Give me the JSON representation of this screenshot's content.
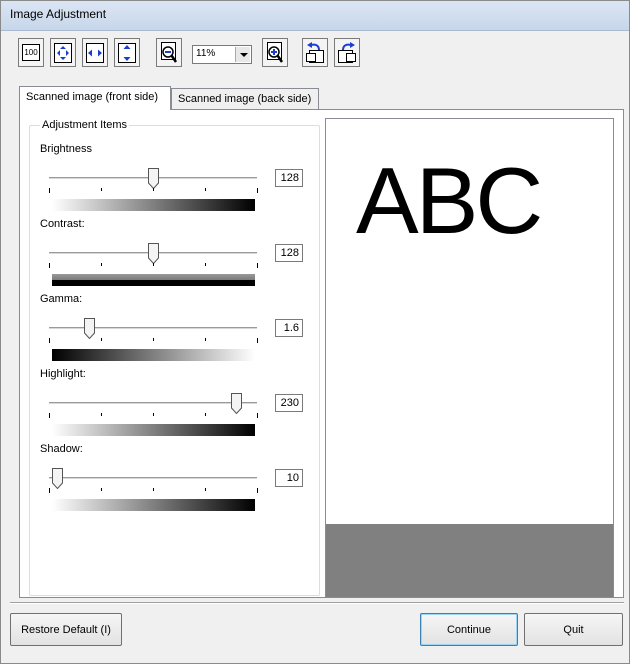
{
  "window": {
    "title": "Image Adjustment"
  },
  "toolbar": {
    "buttons": [
      {
        "name": "actual-size-icon",
        "label": "100"
      },
      {
        "name": "fit-page-icon"
      },
      {
        "name": "fit-width-icon"
      },
      {
        "name": "fit-height-icon"
      },
      {
        "name": "zoom-out-icon"
      },
      {
        "name": "zoom-in-icon"
      },
      {
        "name": "rotate-left-icon"
      },
      {
        "name": "rotate-right-icon"
      }
    ],
    "zoom_value": "11%"
  },
  "tabs": [
    {
      "label": "Scanned image (front side)",
      "active": true
    },
    {
      "label": "Scanned image (back side)",
      "active": false
    }
  ],
  "adjustment": {
    "group_label": "Adjustment Items",
    "items": [
      {
        "label": "Brightness",
        "value": "128",
        "level": 0.5,
        "gradient": "light-to-dark"
      },
      {
        "label": "Contrast:",
        "value": "128",
        "level": 0.5,
        "gradient": "flat-gray"
      },
      {
        "label": "Gamma:",
        "value": "1.6",
        "level": 0.19,
        "gradient": "dark-to-light"
      },
      {
        "label": "Highlight:",
        "value": "230",
        "level": 0.9,
        "gradient": "light-to-dark"
      },
      {
        "label": "Shadow:",
        "value": "10",
        "level": 0.04,
        "gradient": "light-to-dark"
      }
    ]
  },
  "preview": {
    "text": "ABC"
  },
  "buttons": {
    "restore_default": "Restore Default (I)",
    "continue": "Continue",
    "quit": "Quit"
  },
  "colors": {
    "titlebar": "#dbe6f4",
    "preview_margin": "#808080"
  }
}
